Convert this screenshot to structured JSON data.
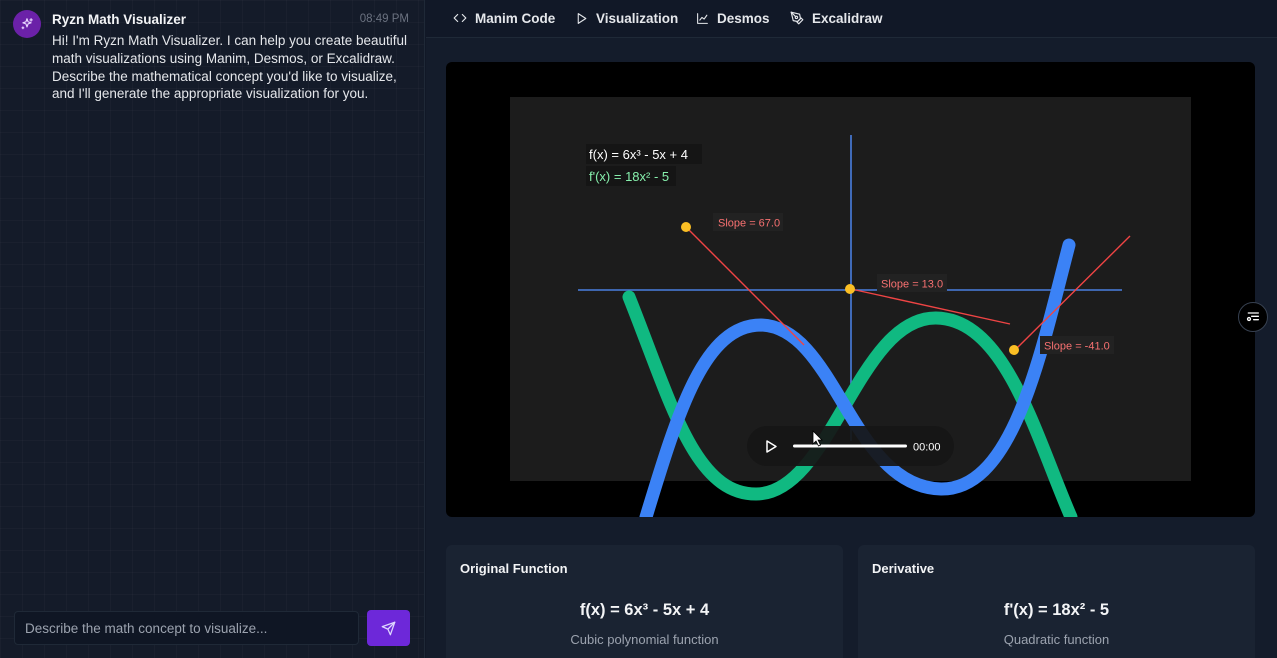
{
  "chat": {
    "bot_name": "Ryzn Math Visualizer",
    "time": "08:49 PM",
    "message": "Hi! I'm Ryzn Math Visualizer. I can help you create beautiful math visualizations using Manim, Desmos, or Excalidraw. Describe the mathematical concept you'd like to visualize, and I'll generate the appropriate visualization for you.",
    "input_placeholder": "Describe the math concept to visualize...",
    "input_value": "",
    "avatar_icon": "sparkle-icon",
    "send_icon": "send-icon",
    "accent": "#6d28d9"
  },
  "tabs": [
    {
      "label": "Manim Code",
      "icon": "code-icon"
    },
    {
      "label": "Visualization",
      "icon": "play-icon"
    },
    {
      "label": "Desmos",
      "icon": "line-chart-icon"
    },
    {
      "label": "Excalidraw",
      "icon": "pen-tool-icon"
    }
  ],
  "video": {
    "legend": [
      {
        "text": "f(x) = 6x³ - 5x + 4",
        "color": "#ffffff"
      },
      {
        "text": "f'(x) = 18x² - 5",
        "color": "#86efac"
      }
    ],
    "slope_labels": [
      "Slope = 67.0",
      "Slope = 13.0",
      "Slope = -41.0"
    ],
    "curve_colors": {
      "function": "#3b82f6",
      "derivative": "#10b981",
      "tangent": "#ef4444",
      "point": "#fbbf24"
    },
    "time": "00:00",
    "progress": 0,
    "play_icon": "play-icon",
    "side_icon": "captions-list-icon"
  },
  "cards": [
    {
      "title": "Original Function",
      "formula": "f(x) = 6x³ - 5x + 4",
      "desc": "Cubic polynomial function"
    },
    {
      "title": "Derivative",
      "formula": "f'(x) = 18x² - 5",
      "desc": "Quadratic function"
    }
  ]
}
